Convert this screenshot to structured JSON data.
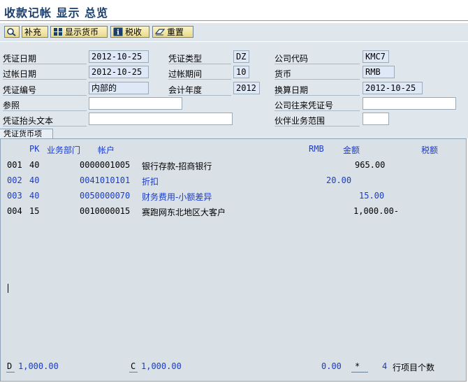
{
  "title": "收款记帐 显示 总览",
  "toolbar": {
    "btn_supplement": "补充",
    "btn_display_currency": "显示货币",
    "btn_tax": "税收",
    "btn_reset": "重置"
  },
  "header": {
    "doc_date_label": "凭证日期",
    "doc_date": "2012-10-25",
    "doc_type_label": "凭证类型",
    "doc_type": "DZ",
    "company_code_label": "公司代码",
    "company_code": "KMC7",
    "posting_date_label": "过帐日期",
    "posting_date": "2012-10-25",
    "period_label": "过帐期间",
    "period": "10",
    "currency_label": "货币",
    "currency": "RMB",
    "doc_number_label": "凭证编号",
    "doc_number": "内部的",
    "fiscal_year_label": "会计年度",
    "fiscal_year": "2012",
    "translation_date_label": "换算日期",
    "translation_date": "2012-10-25",
    "reference_label": "参照",
    "reference": "",
    "cross_cc_label": "公司往来凭证号",
    "cross_cc": "",
    "header_text_label": "凭证抬头文本",
    "header_text": "",
    "partner_ba_label": "伙伴业务范围",
    "partner_ba": ""
  },
  "tab_label": "凭证货币项",
  "table": {
    "col_pk": "PK",
    "col_bizdept": "业务部门",
    "col_account": "帐户",
    "col_currency": "RMB",
    "col_amount": "金额",
    "col_tax": "税额",
    "rows": [
      {
        "no": "001",
        "pk": "40",
        "account": "0000001005",
        "desc": "银行存款-招商银行",
        "amount": "965.00",
        "blue": false
      },
      {
        "no": "002",
        "pk": "40",
        "account": "0041010101",
        "desc": "折扣",
        "amount": "20.00",
        "blue": true
      },
      {
        "no": "003",
        "pk": "40",
        "account": "0050000070",
        "desc": "财务费用-小额差异",
        "amount": "15.00",
        "blue": true
      },
      {
        "no": "004",
        "pk": "15",
        "account": "0010000015",
        "desc": "赛跑网东北地区大客户",
        "amount": "1,000.00-",
        "blue": false
      }
    ]
  },
  "footer": {
    "d_label": "D",
    "d_value": "1,000.00",
    "c_label": "C",
    "c_value": "1,000.00",
    "balance": "0.00",
    "star": "*",
    "count": "4",
    "count_label": "行项目个数"
  },
  "colors": {
    "title": "#1b3f6c",
    "background": "#dfe6ec",
    "panel": "#d9e0e6",
    "blue_text": "#1a3cc8",
    "field_readonly": "#dfe8f7"
  }
}
